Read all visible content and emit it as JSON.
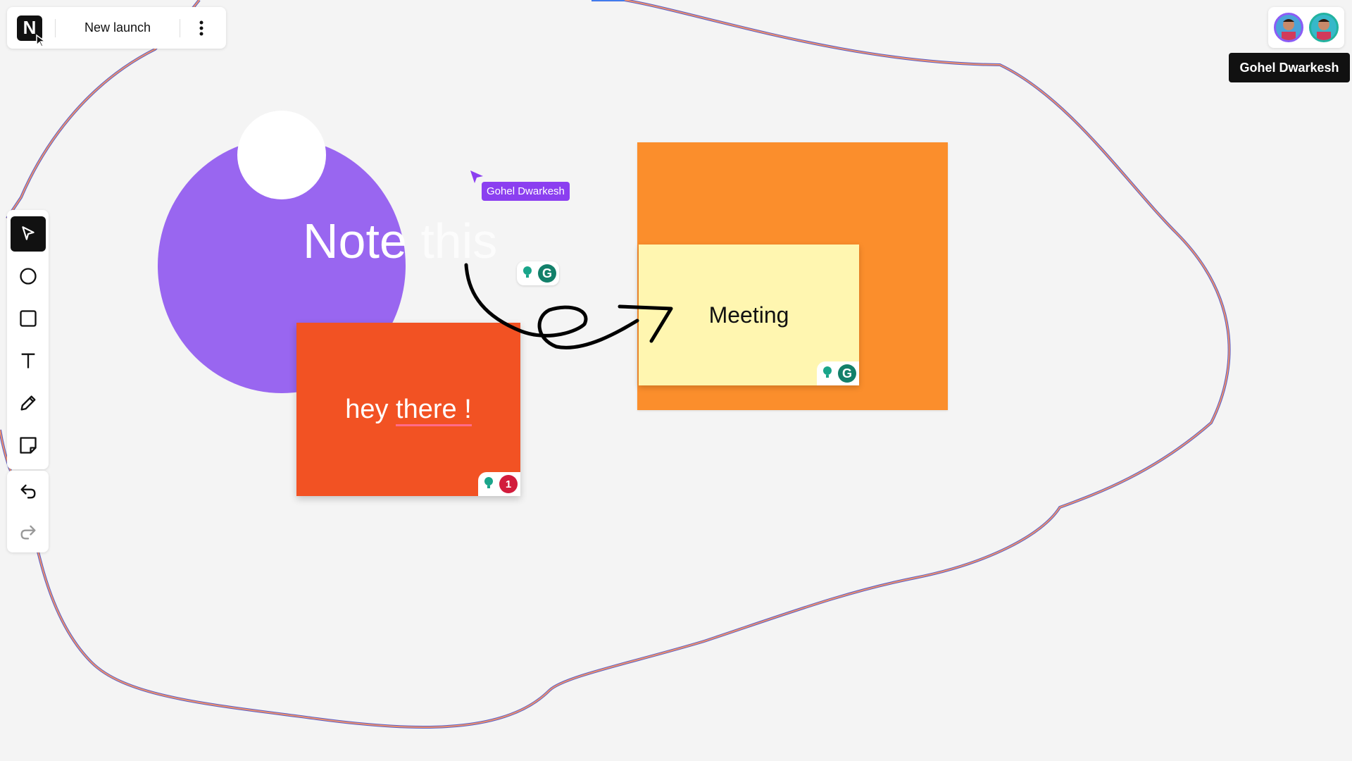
{
  "app": {
    "logo_letter": "N",
    "document_title": "New launch"
  },
  "collaborators": {
    "tooltip": "Gohel Dwarkesh",
    "remote_cursor_label": "Gohel Dwarkesh",
    "cursor_color": "#8b3ff0"
  },
  "toolbar": {
    "tools": [
      "select-icon",
      "circle-icon",
      "rectangle-icon",
      "text-icon",
      "pencil-icon",
      "sticky-note-icon"
    ],
    "history": [
      "undo-icon",
      "redo-icon"
    ]
  },
  "canvas": {
    "circle_text_1": "Note",
    "circle_text_2": "this",
    "red_card_text_1": "hey",
    "red_card_text_2": "there !",
    "sticky_text": "Meeting",
    "grammar_issue_count": "1",
    "colors": {
      "purple": "#9966f0",
      "red": "#f25223",
      "orange": "#fb8e2c",
      "sticky": "#fff6b0",
      "background": "#f4f4f4"
    }
  }
}
